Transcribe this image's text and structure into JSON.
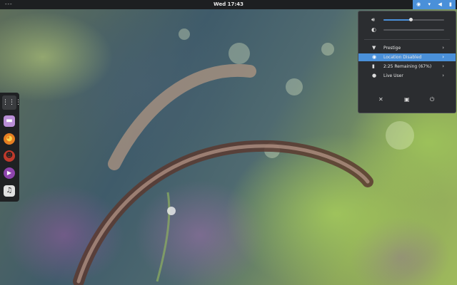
{
  "topbar": {
    "activities_label": "---",
    "clock": "Wed 17:43",
    "status_icons": [
      "screen-icon",
      "wifi-icon",
      "volume-icon",
      "battery-icon"
    ]
  },
  "system_menu": {
    "volume": {
      "icon": "volume-icon",
      "level": 0.45
    },
    "brightness": {
      "icon": "brightness-icon",
      "level": 0.0
    },
    "items": [
      {
        "icon": "wifi-icon",
        "label": "Prestige",
        "active": false
      },
      {
        "icon": "location-icon",
        "label": "Location Disabled",
        "active": true
      },
      {
        "icon": "battery-icon",
        "label": "2:25 Remaining (67%)",
        "active": false
      },
      {
        "icon": "user-icon",
        "label": "Live User",
        "active": false
      }
    ],
    "actions": [
      "settings-icon",
      "lock-icon",
      "power-icon"
    ]
  },
  "dash": {
    "items": [
      {
        "name": "show-applications",
        "icon": "grid-icon",
        "color": "#3a3c3f"
      },
      {
        "name": "files",
        "icon": "folder-icon",
        "color": "#b98ed6"
      },
      {
        "name": "firefox",
        "icon": "firefox-icon",
        "color": "#e67e22"
      },
      {
        "name": "rhythmbox-ghost",
        "icon": "ghost-icon",
        "color": "#c0392b"
      },
      {
        "name": "totem",
        "icon": "play-icon",
        "color": "#8e44ad"
      },
      {
        "name": "music",
        "icon": "music-note-icon",
        "color": "#e0e0e0"
      }
    ]
  },
  "colors": {
    "accent": "#4a90d9",
    "panel": "#1d1f21",
    "menu_bg": "#2b2d30"
  }
}
